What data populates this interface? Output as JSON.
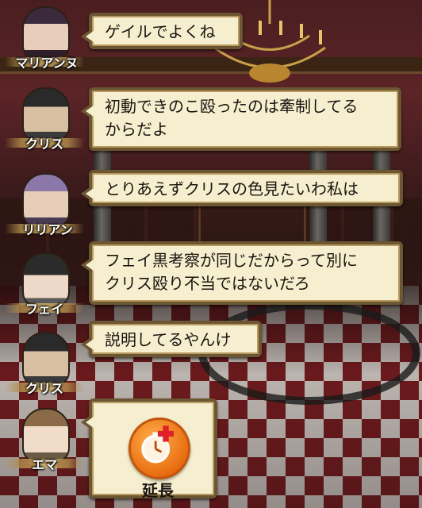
{
  "messages": [
    {
      "speaker": "マリアンヌ",
      "lines": [
        "ゲイルでよくね"
      ]
    },
    {
      "speaker": "クリス",
      "lines": [
        "初動できのこ殴ったのは牽制してる",
        "からだよ"
      ]
    },
    {
      "speaker": "リリアン",
      "lines": [
        "とりあえずクリスの色見たいわ私は"
      ]
    },
    {
      "speaker": "フェイ",
      "lines": [
        "フェイ黒考察が同じだからって別に",
        "クリス殴り不当ではないだろ"
      ]
    },
    {
      "speaker": "クリス",
      "lines": [
        "説明してるやんけ"
      ]
    },
    {
      "speaker": "エマ",
      "action": {
        "label": "延長",
        "icon": "stopwatch-plus-icon"
      }
    }
  ],
  "colors": {
    "bubble_bg": "#f6efcf",
    "bubble_border": "#6d5632",
    "extend_button": "#e96d12",
    "plus_cross": "#e0202a"
  }
}
